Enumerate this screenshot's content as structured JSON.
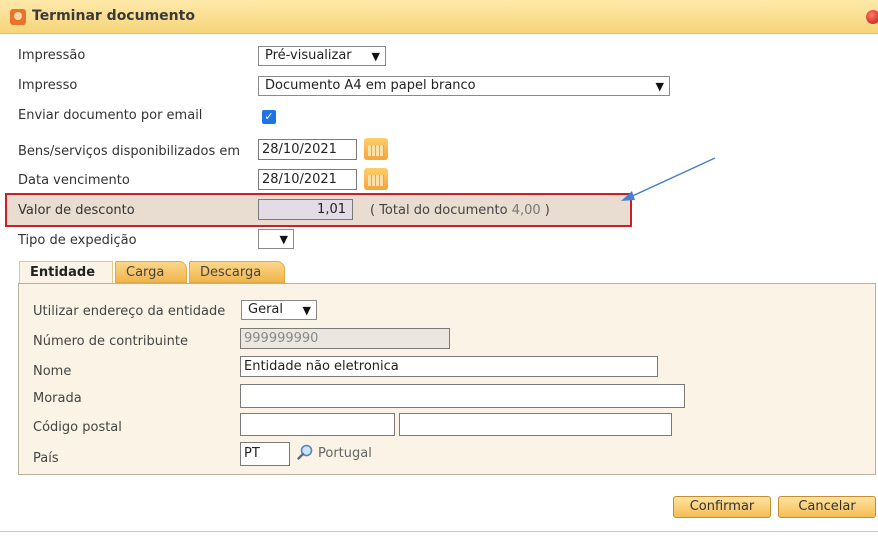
{
  "window": {
    "title": "Terminar documento"
  },
  "form": {
    "impressao": {
      "label": "Impressão",
      "value": "Pré-visualizar"
    },
    "impresso": {
      "label": "Impresso",
      "value": "Documento A4 em papel branco"
    },
    "enviar_email": {
      "label": "Enviar documento por email",
      "checked": true,
      "check_glyph": "✓"
    },
    "bens_servicos": {
      "label": "Bens/serviços disponibilizados em",
      "value": "28/10/2021"
    },
    "data_vencimento": {
      "label": "Data vencimento",
      "value": "28/10/2021"
    },
    "valor_desconto": {
      "label": "Valor de desconto",
      "value": "1,01",
      "total_prefix": "( Total do documento ",
      "total_value": "4,00",
      "total_suffix": " )"
    },
    "tipo_expedicao": {
      "label": "Tipo de expedição",
      "value": ""
    }
  },
  "tabs": [
    {
      "label": "Entidade",
      "active": true
    },
    {
      "label": "Carga",
      "active": false
    },
    {
      "label": "Descarga",
      "active": false
    }
  ],
  "entidade": {
    "utilizar_endereco": {
      "label": "Utilizar endereço da entidade",
      "value": "Geral"
    },
    "numero_contribuinte": {
      "label": "Número de contribuinte",
      "value": "999999990"
    },
    "nome": {
      "label": "Nome",
      "value": "Entidade não eletronica"
    },
    "morada": {
      "label": "Morada",
      "value": ""
    },
    "codigo_postal": {
      "label": "Código postal",
      "value1": "",
      "value2": ""
    },
    "pais": {
      "label": "País",
      "code": "PT",
      "name": "Portugal"
    }
  },
  "buttons": {
    "confirm": "Confirmar",
    "cancel": "Cancelar"
  },
  "icons": {
    "chevron": "chevron-down-icon",
    "calendar": "calendar-icon",
    "search": "magnifier-icon",
    "close": "close-icon",
    "app": "app-logo-icon"
  },
  "colors": {
    "accent": "#f5bd55",
    "highlight_border": "#cc1f2a",
    "annotation_arrow": "#4a7fd0"
  }
}
